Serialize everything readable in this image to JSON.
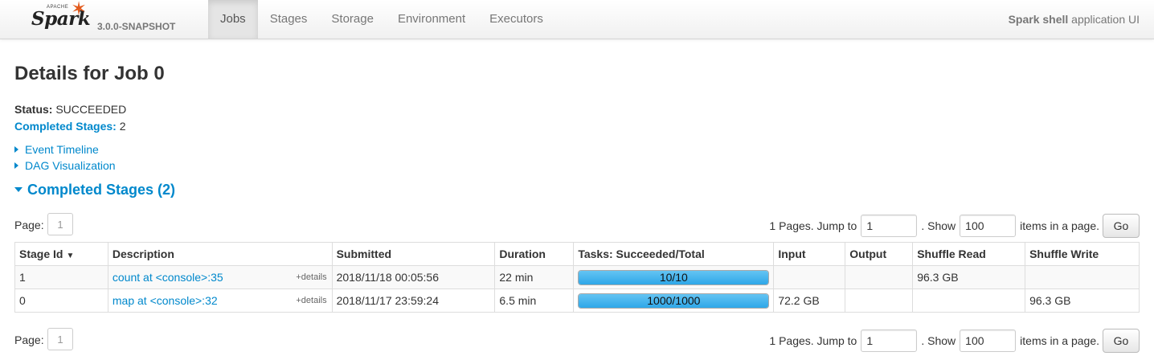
{
  "nav": {
    "brand_apache": "APACHE",
    "brand_name": "Spark",
    "version": "3.0.0-SNAPSHOT",
    "items": [
      {
        "label": "Jobs",
        "active": true
      },
      {
        "label": "Stages",
        "active": false
      },
      {
        "label": "Storage",
        "active": false
      },
      {
        "label": "Environment",
        "active": false
      },
      {
        "label": "Executors",
        "active": false
      }
    ],
    "app_name": "Spark shell",
    "app_suffix": " application UI"
  },
  "page": {
    "title": "Details for Job 0",
    "status_label": "Status:",
    "status_value": "SUCCEEDED",
    "completed_label": "Completed Stages:",
    "completed_value": "2",
    "event_timeline": "Event Timeline",
    "dag_visualization": "DAG Visualization",
    "section_title": "Completed Stages (2)"
  },
  "pager": {
    "page_label": "Page:",
    "page_number": "1",
    "pages_text": "1 Pages. Jump to",
    "jump_value": "1",
    "show_text": ". Show",
    "show_value": "100",
    "items_text": "items in a page.",
    "go_label": "Go"
  },
  "table": {
    "headers": [
      "Stage Id",
      "Description",
      "Submitted",
      "Duration",
      "Tasks: Succeeded/Total",
      "Input",
      "Output",
      "Shuffle Read",
      "Shuffle Write"
    ],
    "sort_indicator": "▼",
    "details_label": "+details",
    "rows": [
      {
        "stage_id": "1",
        "description": "count at <console>:35",
        "submitted": "2018/11/18 00:05:56",
        "duration": "22 min",
        "tasks_text": "10/10",
        "tasks_fraction": 1.0,
        "input": "",
        "output": "",
        "shuffle_read": "96.3 GB",
        "shuffle_write": ""
      },
      {
        "stage_id": "0",
        "description": "map at <console>:32",
        "submitted": "2018/11/17 23:59:24",
        "duration": "6.5 min",
        "tasks_text": "1000/1000",
        "tasks_fraction": 1.0,
        "input": "72.2 GB",
        "output": "",
        "shuffle_read": "",
        "shuffle_write": "96.3 GB"
      }
    ]
  },
  "colors": {
    "link": "#0088cc",
    "progress_fill": "#2ea7e8",
    "spark_star": "#e25a1c"
  }
}
